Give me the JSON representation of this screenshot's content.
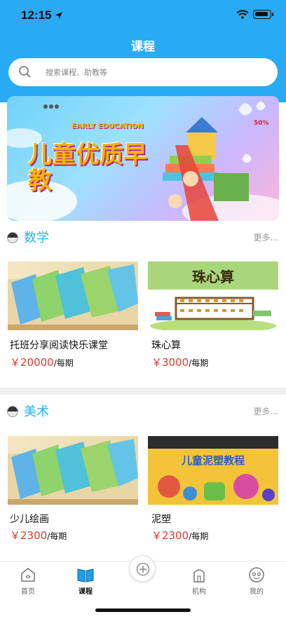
{
  "status_bar": {
    "time": "12:15"
  },
  "header": {
    "title": "课程"
  },
  "search": {
    "placeholder": "搜索课程、助教等"
  },
  "banner": {
    "headline": "儿童优质早教",
    "subtitle": "EARLY EDUCATION",
    "badge": "50%"
  },
  "sections": [
    {
      "title": "数学",
      "more": "更多...",
      "courses": [
        {
          "name": "托班分享阅读快乐课堂",
          "price": "￥20000",
          "unit": "/每期"
        },
        {
          "name": "珠心算",
          "price": "￥3000",
          "unit": "/每期",
          "image_text": "珠心算"
        }
      ]
    },
    {
      "title": "美术",
      "more": "更多...",
      "courses": [
        {
          "name": "少儿绘画",
          "price": "￥2300",
          "unit": "/每期"
        },
        {
          "name": "泥塑",
          "price": "￥2300",
          "unit": "/每期",
          "image_text": "儿童泥塑教程"
        }
      ]
    }
  ],
  "tabbar": {
    "items": [
      {
        "label": "首页"
      },
      {
        "label": "课程"
      },
      {
        "label": "机构"
      },
      {
        "label": "我的"
      }
    ]
  },
  "colors": {
    "header_blue": "#29aaf5",
    "section_title": "#1fb7ea",
    "price_red": "#e23b2b"
  }
}
